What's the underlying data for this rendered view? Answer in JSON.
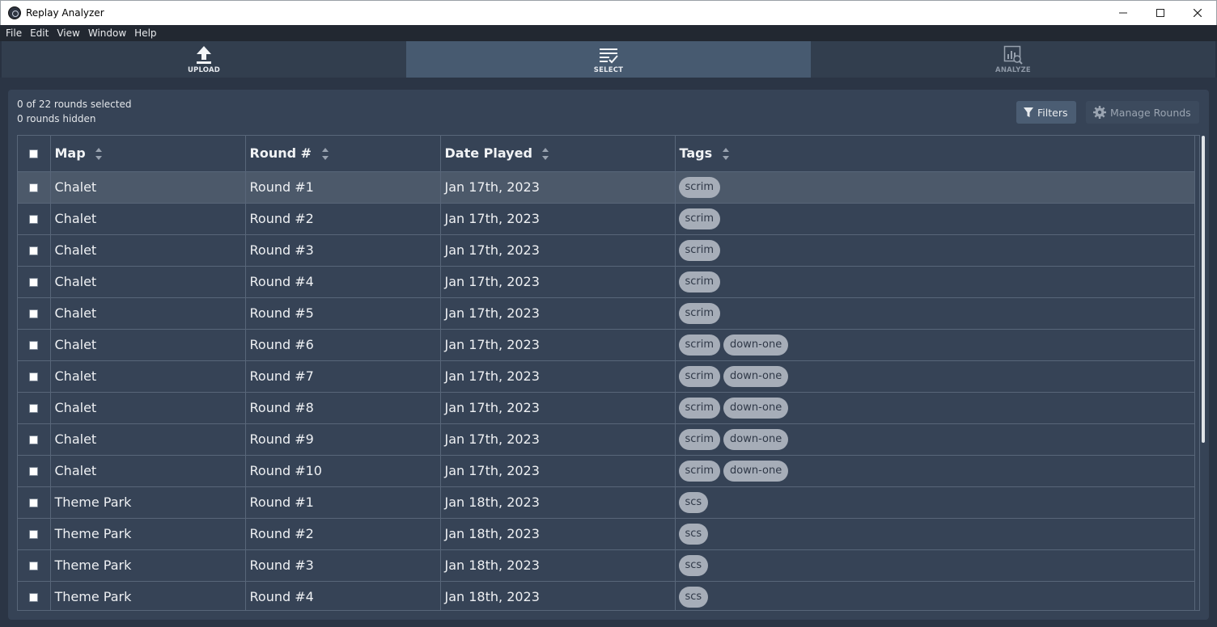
{
  "window": {
    "title": "Replay Analyzer",
    "controls": {
      "minimize": "—",
      "maximize": "☐",
      "close": "✕"
    }
  },
  "menu": [
    "File",
    "Edit",
    "View",
    "Window",
    "Help"
  ],
  "nav": {
    "tabs": [
      {
        "label": "UPLOAD",
        "icon": "upload-icon"
      },
      {
        "label": "SELECT",
        "icon": "select-list-icon",
        "active": true
      },
      {
        "label": "ANALYZE",
        "icon": "analyze-chart-icon"
      }
    ]
  },
  "summary": {
    "selected": "0 of 22 rounds selected",
    "hidden": "0 rounds hidden"
  },
  "toolbar": {
    "filters_label": "Filters",
    "manage_label": "Manage Rounds"
  },
  "table": {
    "headers": [
      "Map",
      "Round #",
      "Date Played",
      "Tags"
    ],
    "rows": [
      {
        "map": "Chalet",
        "round": "Round #1",
        "date": "Jan 17th, 2023",
        "tags": [
          "scrim"
        ]
      },
      {
        "map": "Chalet",
        "round": "Round #2",
        "date": "Jan 17th, 2023",
        "tags": [
          "scrim"
        ]
      },
      {
        "map": "Chalet",
        "round": "Round #3",
        "date": "Jan 17th, 2023",
        "tags": [
          "scrim"
        ]
      },
      {
        "map": "Chalet",
        "round": "Round #4",
        "date": "Jan 17th, 2023",
        "tags": [
          "scrim"
        ]
      },
      {
        "map": "Chalet",
        "round": "Round #5",
        "date": "Jan 17th, 2023",
        "tags": [
          "scrim"
        ]
      },
      {
        "map": "Chalet",
        "round": "Round #6",
        "date": "Jan 17th, 2023",
        "tags": [
          "scrim",
          "down-one"
        ]
      },
      {
        "map": "Chalet",
        "round": "Round #7",
        "date": "Jan 17th, 2023",
        "tags": [
          "scrim",
          "down-one"
        ]
      },
      {
        "map": "Chalet",
        "round": "Round #8",
        "date": "Jan 17th, 2023",
        "tags": [
          "scrim",
          "down-one"
        ]
      },
      {
        "map": "Chalet",
        "round": "Round #9",
        "date": "Jan 17th, 2023",
        "tags": [
          "scrim",
          "down-one"
        ]
      },
      {
        "map": "Chalet",
        "round": "Round #10",
        "date": "Jan 17th, 2023",
        "tags": [
          "scrim",
          "down-one"
        ]
      },
      {
        "map": "Theme Park",
        "round": "Round #1",
        "date": "Jan 18th, 2023",
        "tags": [
          "scs"
        ]
      },
      {
        "map": "Theme Park",
        "round": "Round #2",
        "date": "Jan 18th, 2023",
        "tags": [
          "scs"
        ]
      },
      {
        "map": "Theme Park",
        "round": "Round #3",
        "date": "Jan 18th, 2023",
        "tags": [
          "scs"
        ]
      },
      {
        "map": "Theme Park",
        "round": "Round #4",
        "date": "Jan 18th, 2023",
        "tags": [
          "scs"
        ]
      }
    ]
  },
  "colors": {
    "background": "#2b3545",
    "panel": "#364356",
    "active_tab": "#475a70",
    "tag": "#a6adb8"
  }
}
